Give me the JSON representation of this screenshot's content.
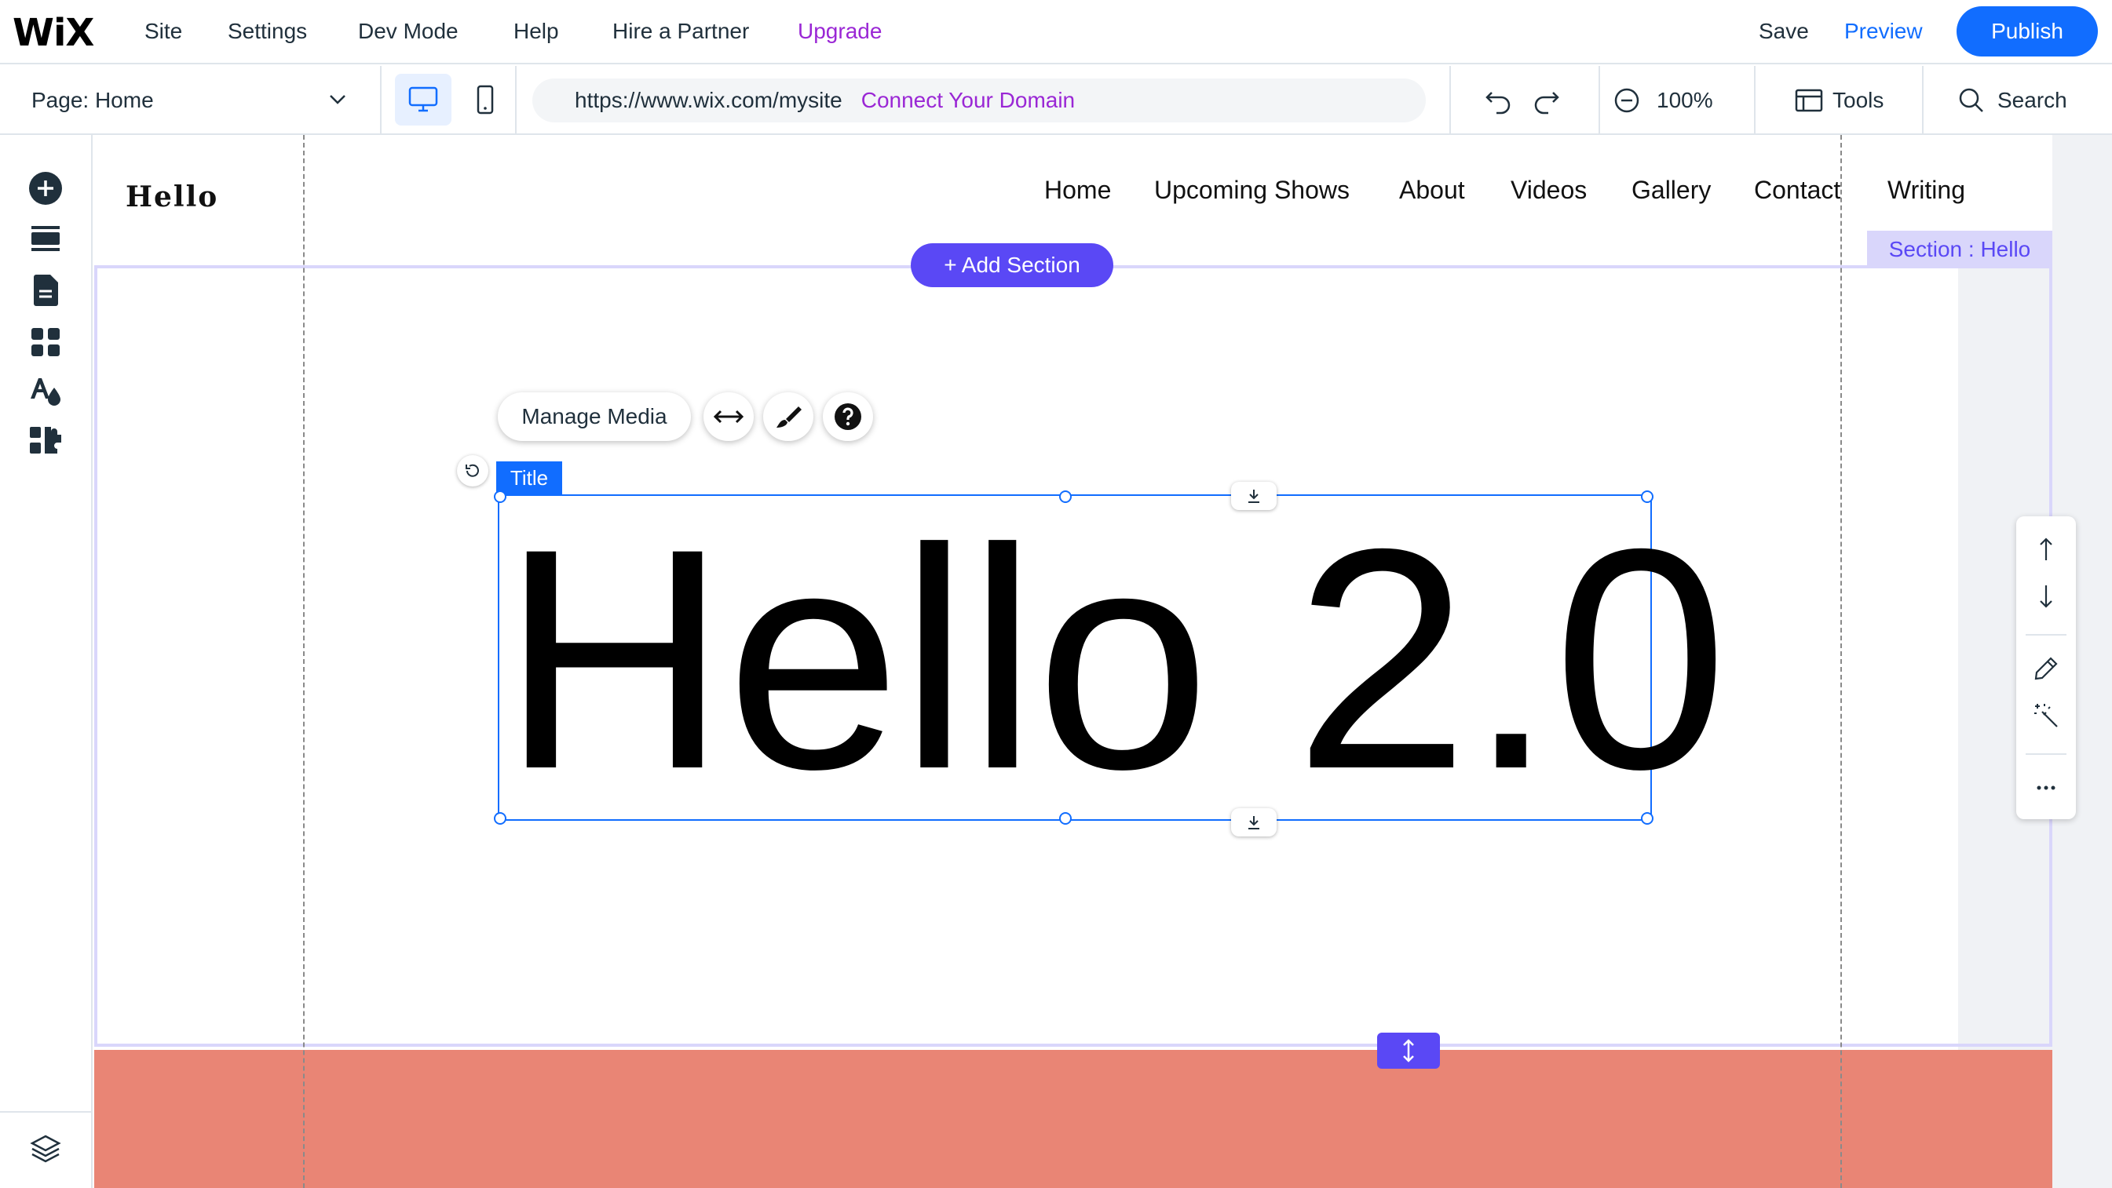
{
  "topbar": {
    "logo": "WiX",
    "menu": [
      "Site",
      "Settings",
      "Dev Mode",
      "Help",
      "Hire a Partner",
      "Upgrade"
    ],
    "save": "Save",
    "preview": "Preview",
    "publish": "Publish"
  },
  "toolbar": {
    "page_select": "Page: Home",
    "url": "https://www.wix.com/mysite",
    "connect_domain": "Connect Your Domain",
    "zoom": "100%",
    "tools": "Tools",
    "search": "Search"
  },
  "left_panel": {
    "icons": [
      "add-elements-icon",
      "sections-icon",
      "pages-icon",
      "apps-icon",
      "site-design-icon",
      "business-apps-icon",
      "layers-icon"
    ]
  },
  "site": {
    "logo": "Hello",
    "nav": [
      "Home",
      "Upcoming Shows",
      "About",
      "Videos",
      "Gallery",
      "Contact",
      "Writing"
    ],
    "add_section": "+ Add Section",
    "section_label": "Section : Hello",
    "manage_media": "Manage Media",
    "title_tag": "Title",
    "title_text": "Hello 2.0"
  },
  "colors": {
    "accent_blue": "#116dff",
    "upgrade_purple": "#9a27d5",
    "section_purple": "#5a48f5",
    "section_frame": "#d9d6fb",
    "footer_section": "#e98575"
  }
}
